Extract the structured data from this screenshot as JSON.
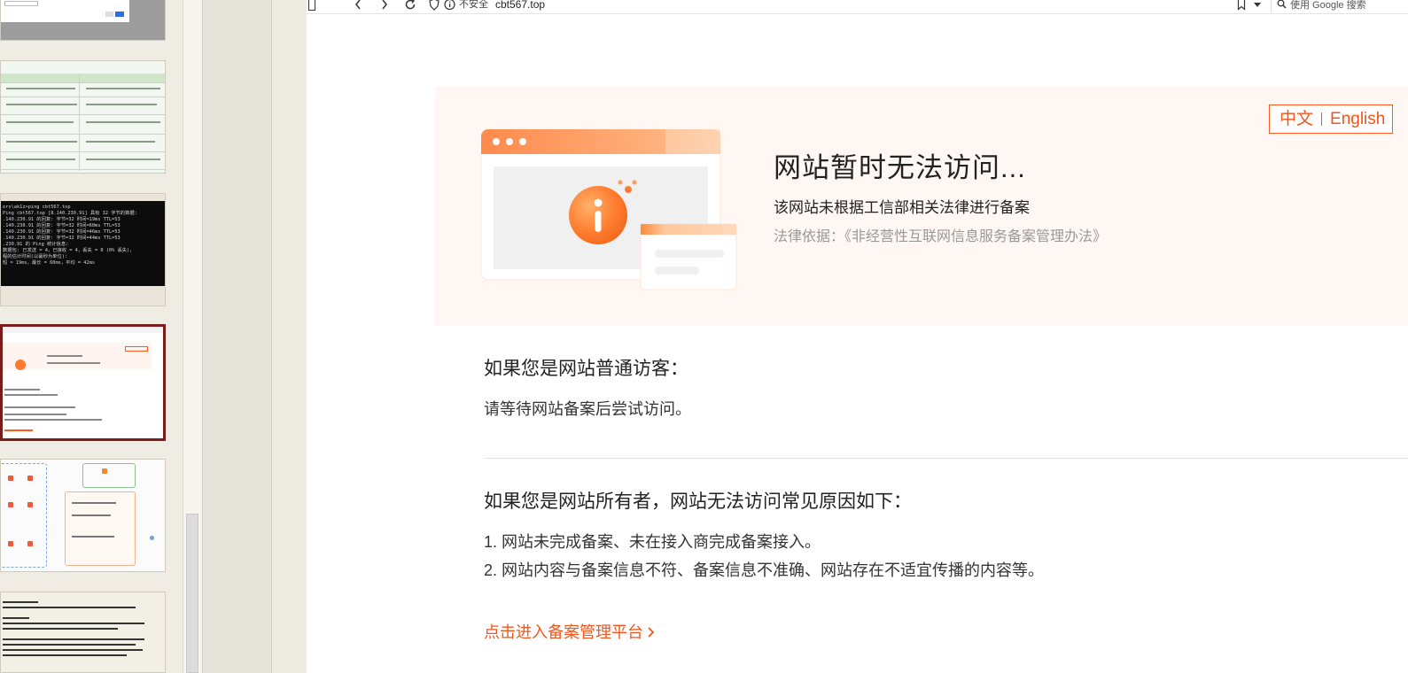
{
  "browser": {
    "insecure_label": "不安全",
    "url": "cbt567.top",
    "search_placeholder": "使用 Google 搜索"
  },
  "thumbnails": {
    "console_lines": [
      "ers\\ak1z>ping cbt567.top",
      "",
      "Ping cbt567.top [8.140.230.91] 具有 32 字节的数据:",
      ".140.230.91 的回复: 字节=32 时间=19ms TTL=53",
      ".140.230.91 的回复: 字节=32 时间=60ms TTL=53",
      ".140.230.91 的回复: 字节=32 时间=46ms TTL=53",
      ".140.230.91 的回复: 字节=32 时间=44ms TTL=53",
      "",
      ".230.91 的 Ping 统计信息:",
      "数据包: 已发送 = 4，已接收 = 4，丢失 = 0 (0% 丢失)，",
      "程的估计时间(以毫秒为单位):",
      "短 = 19ms，最长 = 60ms，平均 = 42ms"
    ]
  },
  "hero": {
    "lang_zh": "中文",
    "lang_en": "English",
    "title": "网站暂时无法访问...",
    "subtitle": "该网站未根据工信部相关法律进行备案",
    "law": "法律依据：《非经营性互联网信息服务备案管理办法》"
  },
  "visitor": {
    "title": "如果您是网站普通访客：",
    "text": "请等待网站备案后尝试访问。"
  },
  "owner": {
    "title": "如果您是网站所有者，网站无法访问常见原因如下：",
    "reasons": [
      "1. 网站未完成备案、未在接入商完成备案接入。",
      "2. 网站内容与备案信息不符、备案信息不准确、网站存在不适宜传播的内容等。"
    ]
  },
  "filing_link": "点击进入备案管理平台",
  "colors": {
    "accent": "#f2561c",
    "hero_bg": "#fff7f3",
    "console_bg": "#0c0c0c",
    "selected_thumb_border": "#7a1c1c"
  }
}
